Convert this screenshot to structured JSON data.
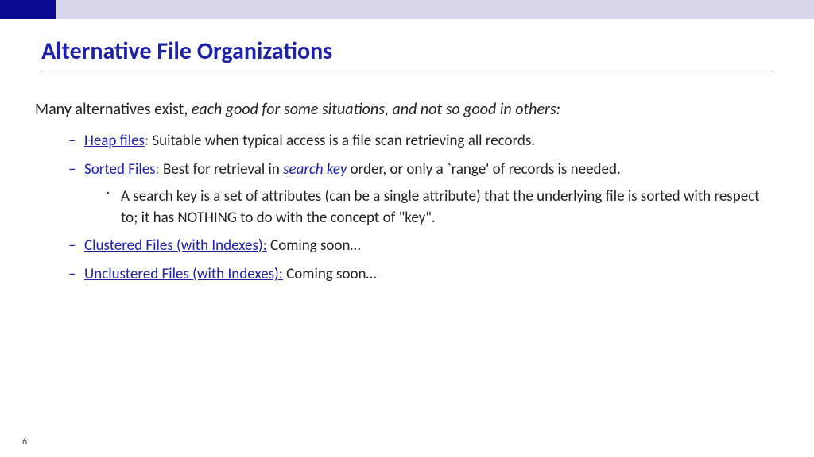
{
  "title": "Alternative File Organizations",
  "intro_plain": "Many alternatives exist, ",
  "intro_italic": "each good for some situations, and not so good in others:",
  "bullets": [
    {
      "term": "Heap files",
      "colon": ":",
      "rest": "  Suitable when typical access is a file scan retrieving all records."
    },
    {
      "term": "Sorted Files",
      "colon": ":",
      "rest_a": "  Best for retrieval in ",
      "rest_em": "search key",
      "rest_b": " order, or only a `range' of records is needed.",
      "sub": "A search key is a set of attributes (can be a single attribute) that the underlying file is sorted with respect to; it has NOTHING to do with the concept of \"key\"."
    },
    {
      "term": "Clustered Files (with Indexes):",
      "rest": " Coming soon…"
    },
    {
      "term": "Unclustered Files (with Indexes):",
      "rest": " Coming soon…"
    }
  ],
  "page_number": "6"
}
